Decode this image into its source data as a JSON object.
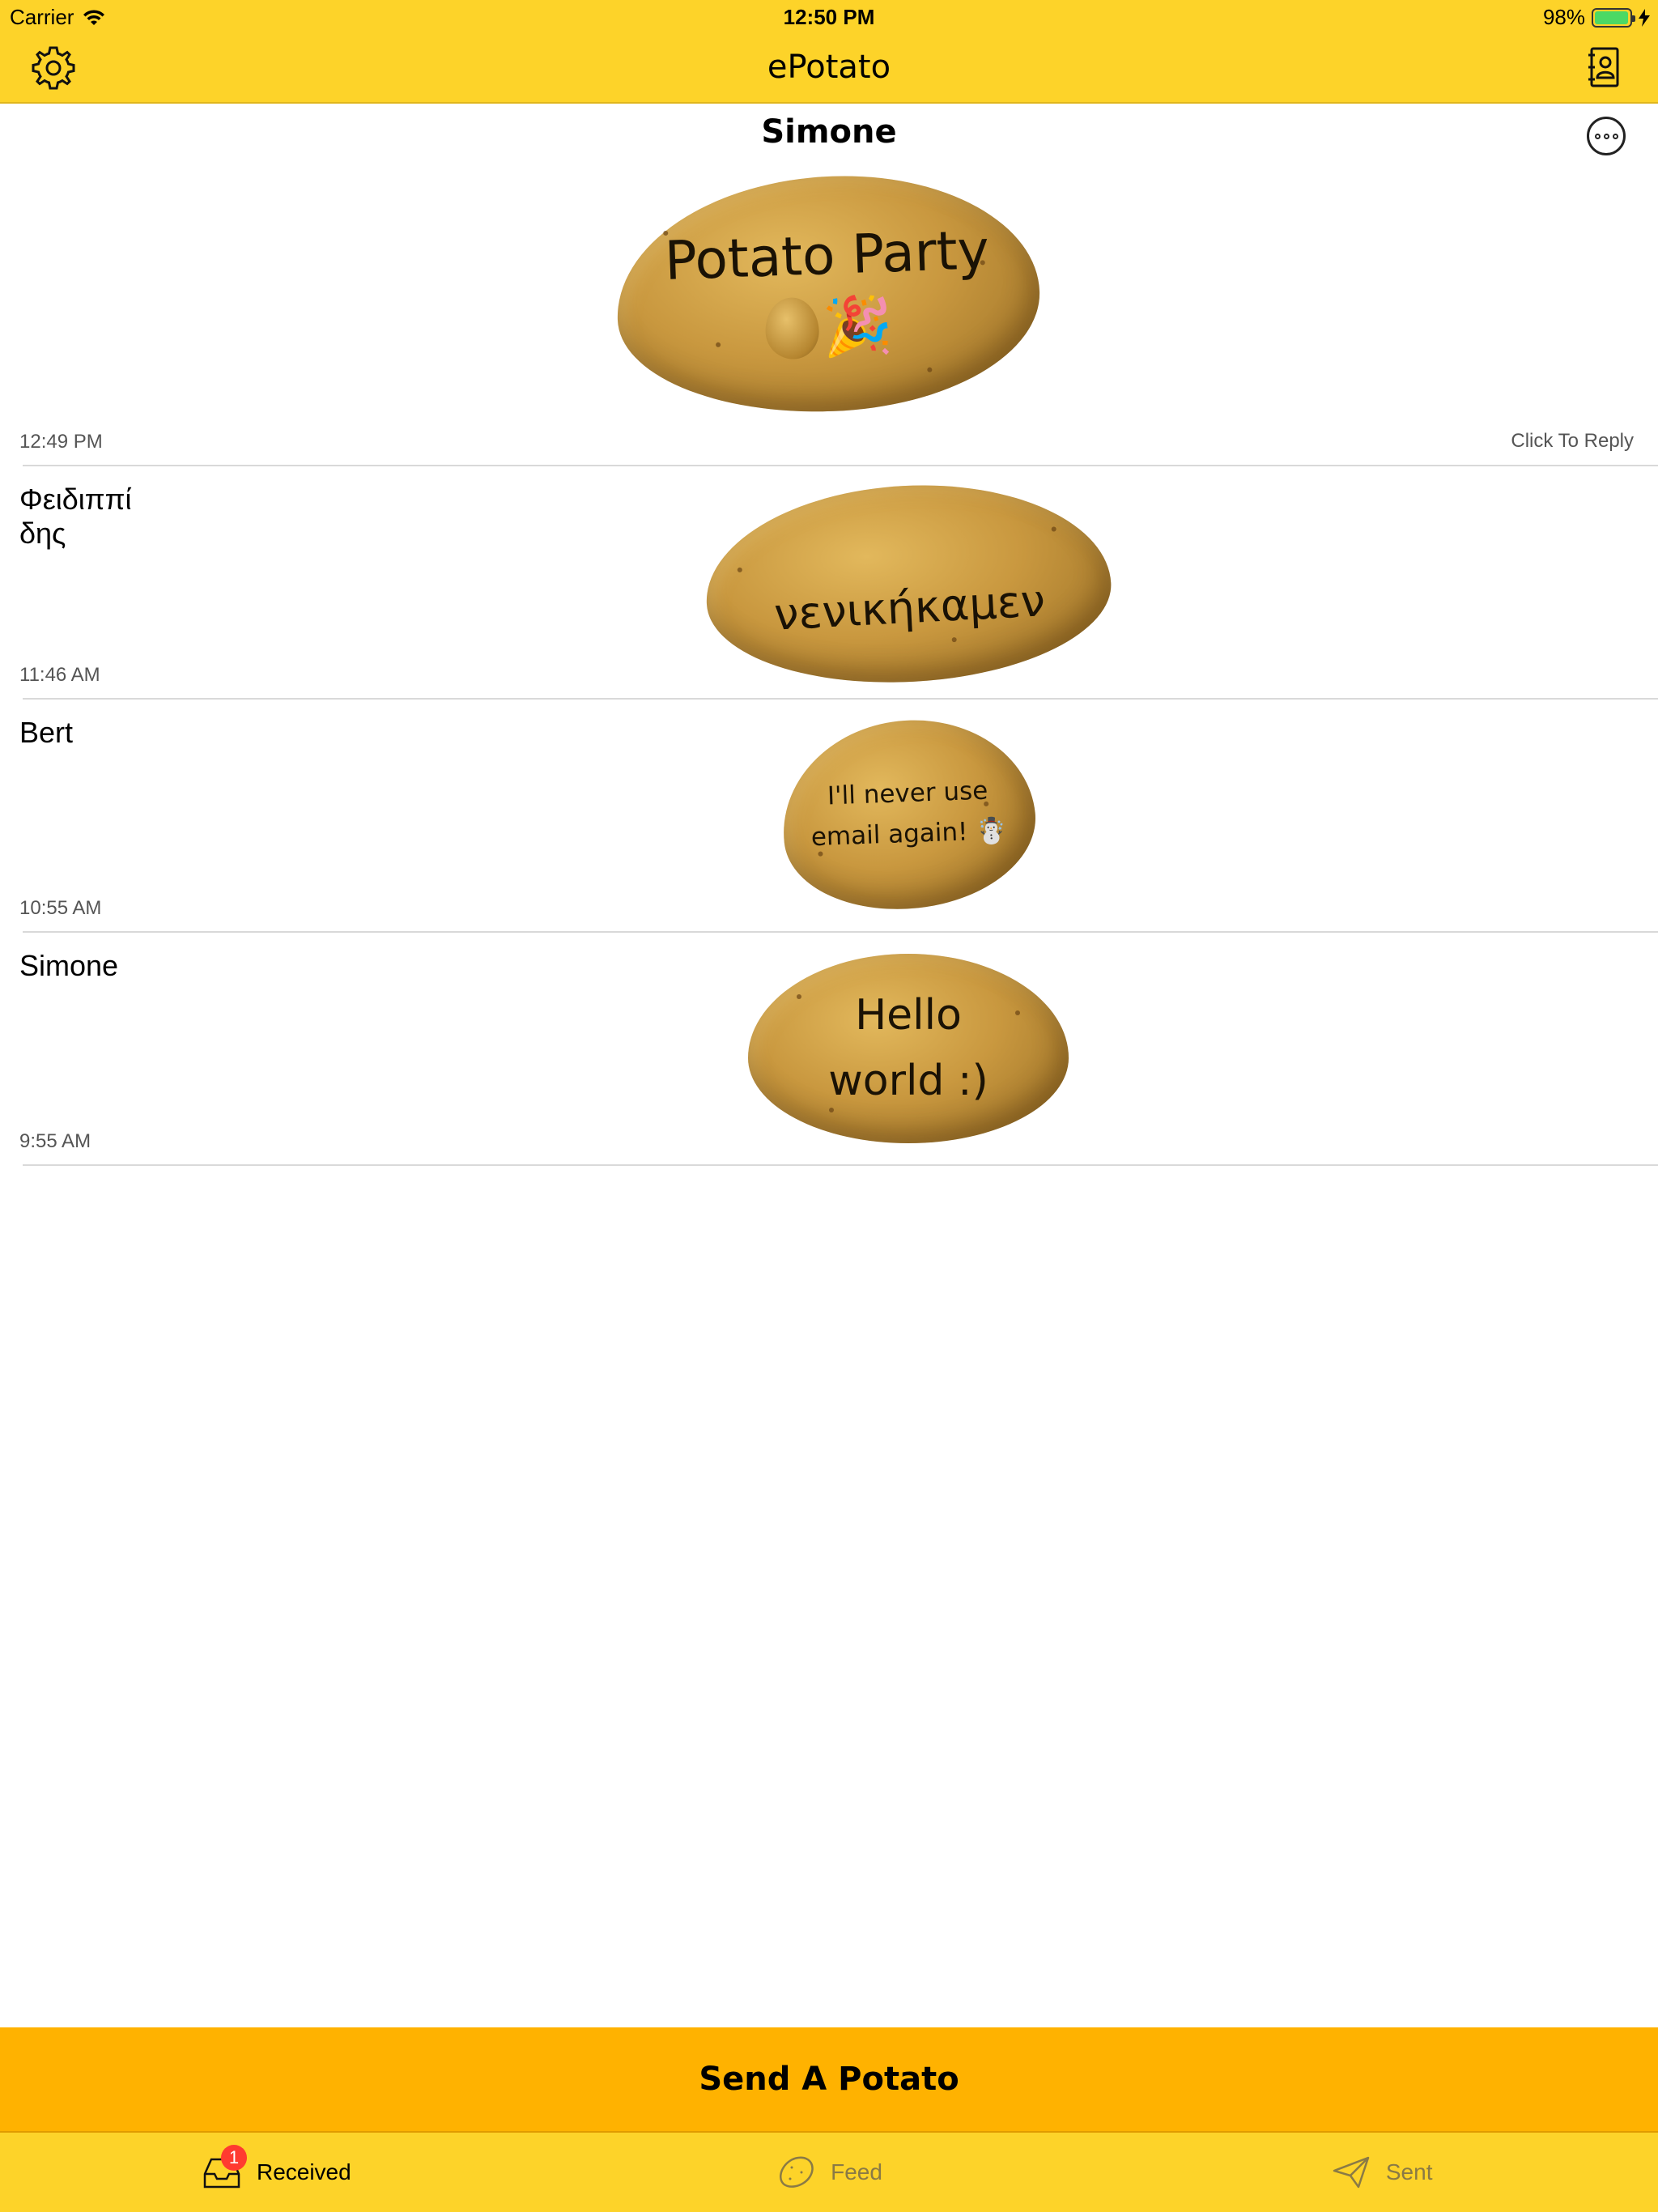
{
  "status_bar": {
    "carrier": "Carrier",
    "time": "12:50 PM",
    "battery": "98%",
    "battery_level": 0.98
  },
  "nav": {
    "title": "ePotato",
    "left_icon": "gear-icon",
    "right_icon": "contacts-book-icon"
  },
  "featured": {
    "sender": "Simone",
    "potato_text": "Potato Party",
    "potato_emoji": "🎉",
    "time": "12:49 PM",
    "reply_label": "Click To Reply",
    "more_icon": "more-options-icon"
  },
  "messages": [
    {
      "sender": "Φειδιππί\nδης",
      "potato_text": "νενικήκαμεν",
      "time": "11:46 AM"
    },
    {
      "sender": "Bert",
      "potato_text_line1": "I'll never use",
      "potato_text_line2": "email again! ☃️",
      "time": "10:55 AM"
    },
    {
      "sender": "Simone",
      "potato_text_line1": "Hello",
      "potato_text_line2": "world :)",
      "time": "9:55 AM"
    }
  ],
  "send_button": {
    "label": "Send A Potato"
  },
  "tabs": [
    {
      "label": "Received",
      "icon": "inbox-tray-icon",
      "badge": "1",
      "active": true
    },
    {
      "label": "Feed",
      "icon": "potato-outline-icon",
      "active": false
    },
    {
      "label": "Sent",
      "icon": "paper-plane-icon",
      "active": false
    }
  ],
  "colors": {
    "nav_yellow": "#FDD329",
    "send_orange": "#FFB200",
    "badge_red": "#FF3B30",
    "battery_green": "#4CD964"
  }
}
